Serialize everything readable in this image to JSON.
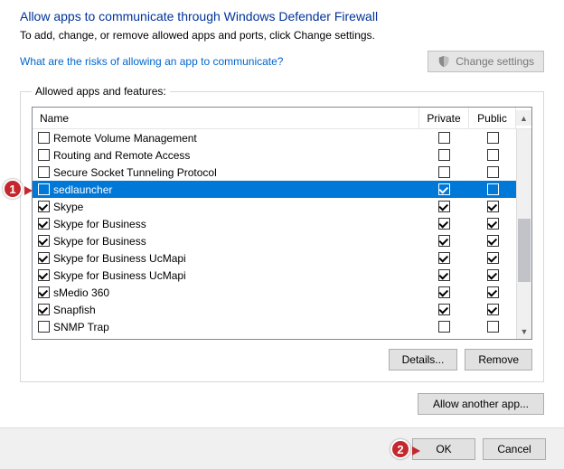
{
  "header": {
    "title": "Allow apps to communicate through Windows Defender Firewall",
    "subtitle": "To add, change, or remove allowed apps and ports, click Change settings.",
    "risks_link": "What are the risks of allowing an app to communicate?",
    "change_settings": "Change settings"
  },
  "list": {
    "legend": "Allowed apps and features:",
    "col_name": "Name",
    "col_private": "Private",
    "col_public": "Public"
  },
  "rows": [
    {
      "name": "Remote Volume Management",
      "enabled": false,
      "private": false,
      "public": false,
      "selected": false
    },
    {
      "name": "Routing and Remote Access",
      "enabled": false,
      "private": false,
      "public": false,
      "selected": false
    },
    {
      "name": "Secure Socket Tunneling Protocol",
      "enabled": false,
      "private": false,
      "public": false,
      "selected": false
    },
    {
      "name": "sedlauncher",
      "enabled": false,
      "private": true,
      "public": false,
      "selected": true
    },
    {
      "name": "Skype",
      "enabled": true,
      "private": true,
      "public": true,
      "selected": false
    },
    {
      "name": "Skype for Business",
      "enabled": true,
      "private": true,
      "public": true,
      "selected": false
    },
    {
      "name": "Skype for Business",
      "enabled": true,
      "private": true,
      "public": true,
      "selected": false
    },
    {
      "name": "Skype for Business UcMapi",
      "enabled": true,
      "private": true,
      "public": true,
      "selected": false
    },
    {
      "name": "Skype for Business UcMapi",
      "enabled": true,
      "private": true,
      "public": true,
      "selected": false
    },
    {
      "name": "sMedio 360",
      "enabled": true,
      "private": true,
      "public": true,
      "selected": false
    },
    {
      "name": "Snapfish",
      "enabled": true,
      "private": true,
      "public": true,
      "selected": false
    },
    {
      "name": "SNMP Trap",
      "enabled": false,
      "private": false,
      "public": false,
      "selected": false
    }
  ],
  "buttons": {
    "details": "Details...",
    "remove": "Remove",
    "allow_another": "Allow another app...",
    "ok": "OK",
    "cancel": "Cancel"
  },
  "badges": {
    "one": "1",
    "two": "2"
  }
}
